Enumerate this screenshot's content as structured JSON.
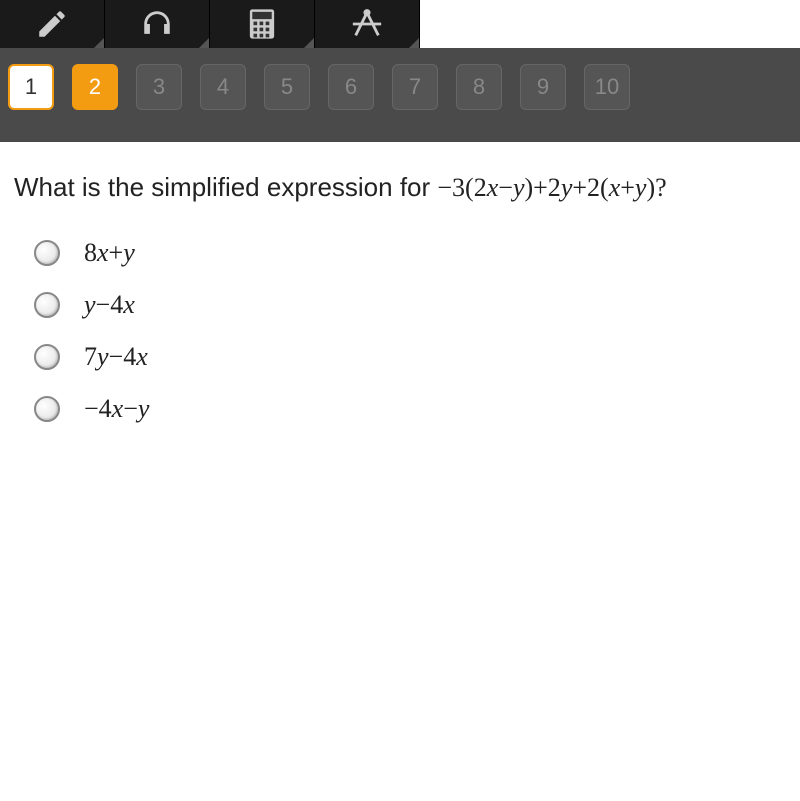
{
  "toolbar": {
    "tools": [
      {
        "name": "pencil"
      },
      {
        "name": "headphones"
      },
      {
        "name": "calculator"
      },
      {
        "name": "compass"
      }
    ]
  },
  "navigation": {
    "items": [
      {
        "label": "1",
        "state": "completed"
      },
      {
        "label": "2",
        "state": "current"
      },
      {
        "label": "3",
        "state": "disabled"
      },
      {
        "label": "4",
        "state": "disabled"
      },
      {
        "label": "5",
        "state": "disabled"
      },
      {
        "label": "6",
        "state": "disabled"
      },
      {
        "label": "7",
        "state": "disabled"
      },
      {
        "label": "8",
        "state": "disabled"
      },
      {
        "label": "9",
        "state": "disabled"
      },
      {
        "label": "10",
        "state": "disabled"
      }
    ]
  },
  "question": {
    "prompt_prefix": "What is the simplified expression for ",
    "expression": "−3(2x−y)+2y+2(x+y)?",
    "options": [
      {
        "text": "8x+y"
      },
      {
        "text": "y−4x"
      },
      {
        "text": "7y−4x"
      },
      {
        "text": "−4x−y"
      }
    ]
  }
}
